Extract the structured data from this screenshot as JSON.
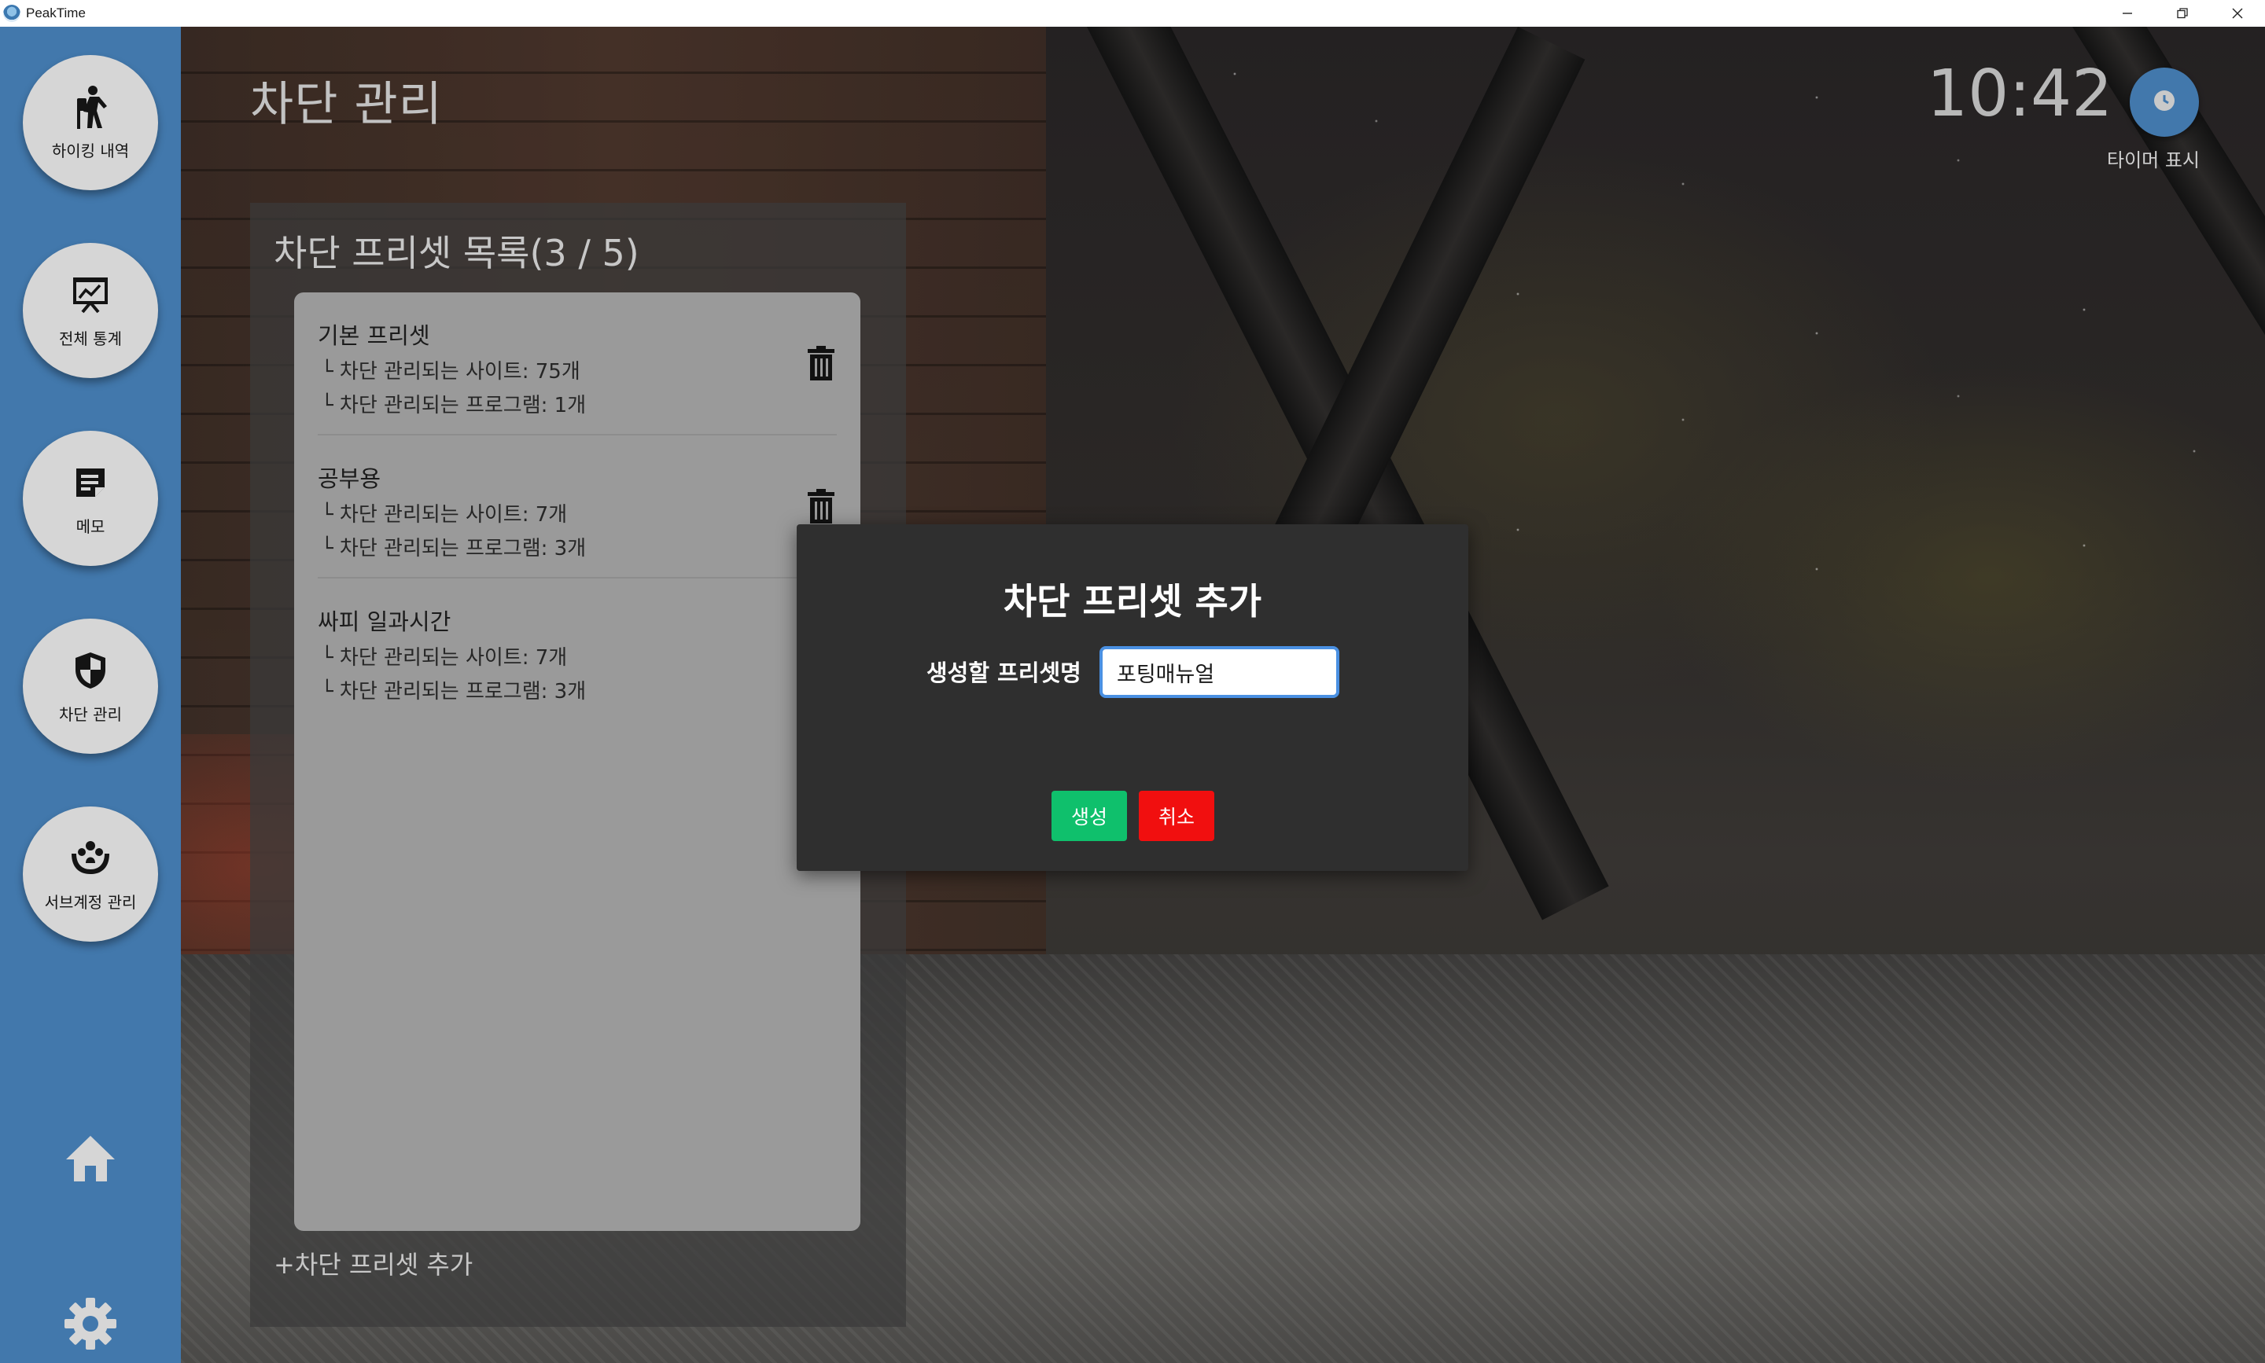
{
  "window": {
    "title": "PeakTime",
    "controls": [
      "minimize-icon",
      "restore-icon",
      "close-icon"
    ]
  },
  "sidebar": {
    "items": [
      {
        "label": "하이킹 내역",
        "icon": "hiking-icon"
      },
      {
        "label": "전체 통계",
        "icon": "chart-board-icon"
      },
      {
        "label": "메모",
        "icon": "memo-icon"
      },
      {
        "label": "차단 관리",
        "icon": "shield-icon"
      },
      {
        "label": "서브계정 관리",
        "icon": "people-hands-icon"
      }
    ],
    "bottom": [
      "home-icon",
      "gear-icon"
    ],
    "color": "#4278ac"
  },
  "header": {
    "page_title": "차단 관리",
    "clock": "10:42",
    "timer_label": "타이머 표시"
  },
  "preset_panel": {
    "title": "차단 프리셋 목록(3 / 5)",
    "presets": [
      {
        "name": "기본 프리셋",
        "sites": "└ 차단 관리되는 사이트: 75개",
        "programs": "└ 차단 관리되는 프로그램: 1개"
      },
      {
        "name": "공부용",
        "sites": "└ 차단 관리되는 사이트: 7개",
        "programs": "└ 차단 관리되는 프로그램: 3개"
      },
      {
        "name": "싸피 일과시간",
        "sites": "└ 차단 관리되는 사이트: 7개",
        "programs": "└ 차단 관리되는 프로그램: 3개"
      }
    ],
    "add_label": "+차단 프리셋 추가"
  },
  "modal": {
    "title": "차단 프리셋 추가",
    "field_label": "생성할 프리셋명",
    "field_value": "포팅매뉴얼",
    "create_label": "생성",
    "cancel_label": "취소",
    "create_color": "#0fc06c",
    "cancel_color": "#f10f0f"
  }
}
